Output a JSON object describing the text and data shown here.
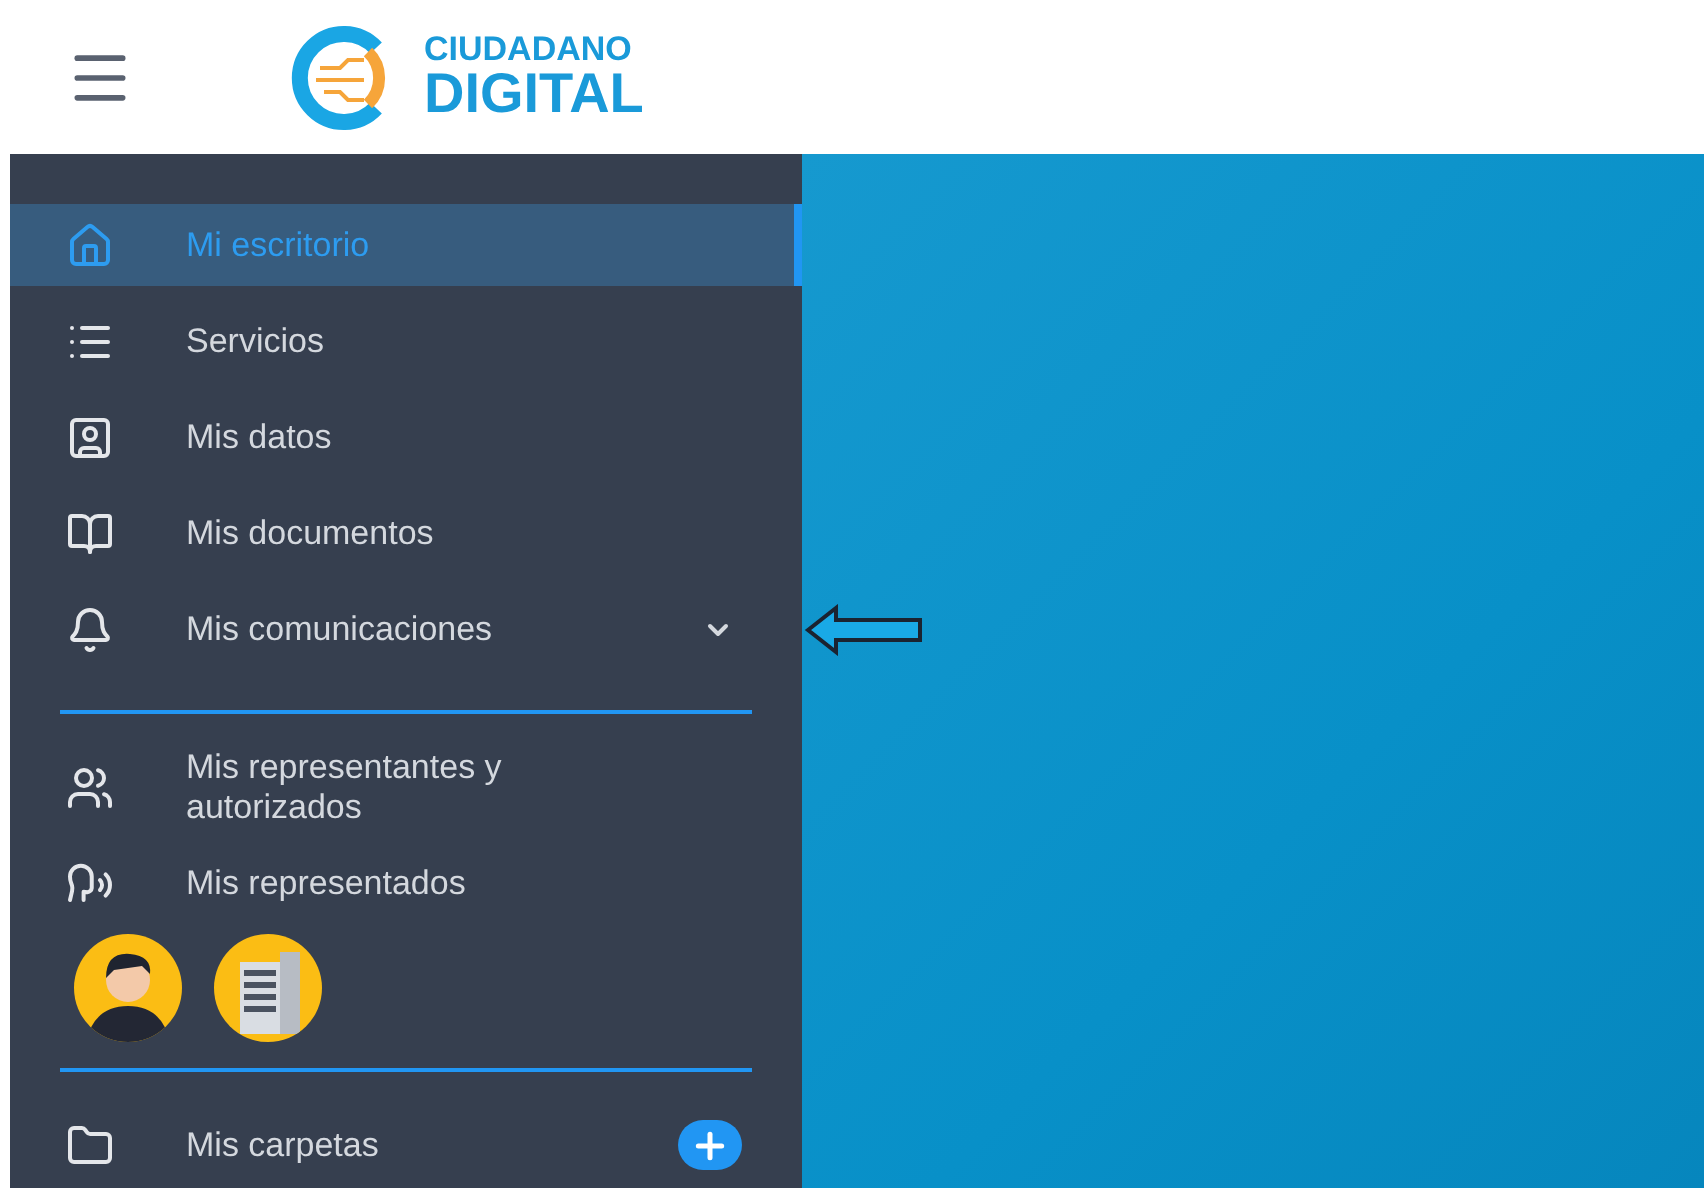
{
  "header": {
    "logo": {
      "line_1": "CIUDADANO",
      "line_2": "DIGITAL"
    }
  },
  "sidebar": {
    "sections": [
      {
        "items": [
          {
            "label": "Mi escritorio",
            "selected": true
          },
          {
            "label": "Servicios",
            "selected": false
          },
          {
            "label": "Mis datos",
            "selected": false
          },
          {
            "label": "Mis documentos",
            "selected": false
          },
          {
            "label": "Mis comunicaciones",
            "selected": false,
            "expanded": false
          }
        ]
      },
      {
        "items": [
          {
            "label": "Mis representantes y autorizados",
            "selected": false
          },
          {
            "label": "Mis representados",
            "selected": false
          }
        ],
        "profiles": [
          {
            "kind": "person"
          },
          {
            "kind": "company"
          }
        ]
      },
      {
        "items": [
          {
            "label": "Mis carpetas",
            "selected": false
          }
        ]
      }
    ]
  }
}
